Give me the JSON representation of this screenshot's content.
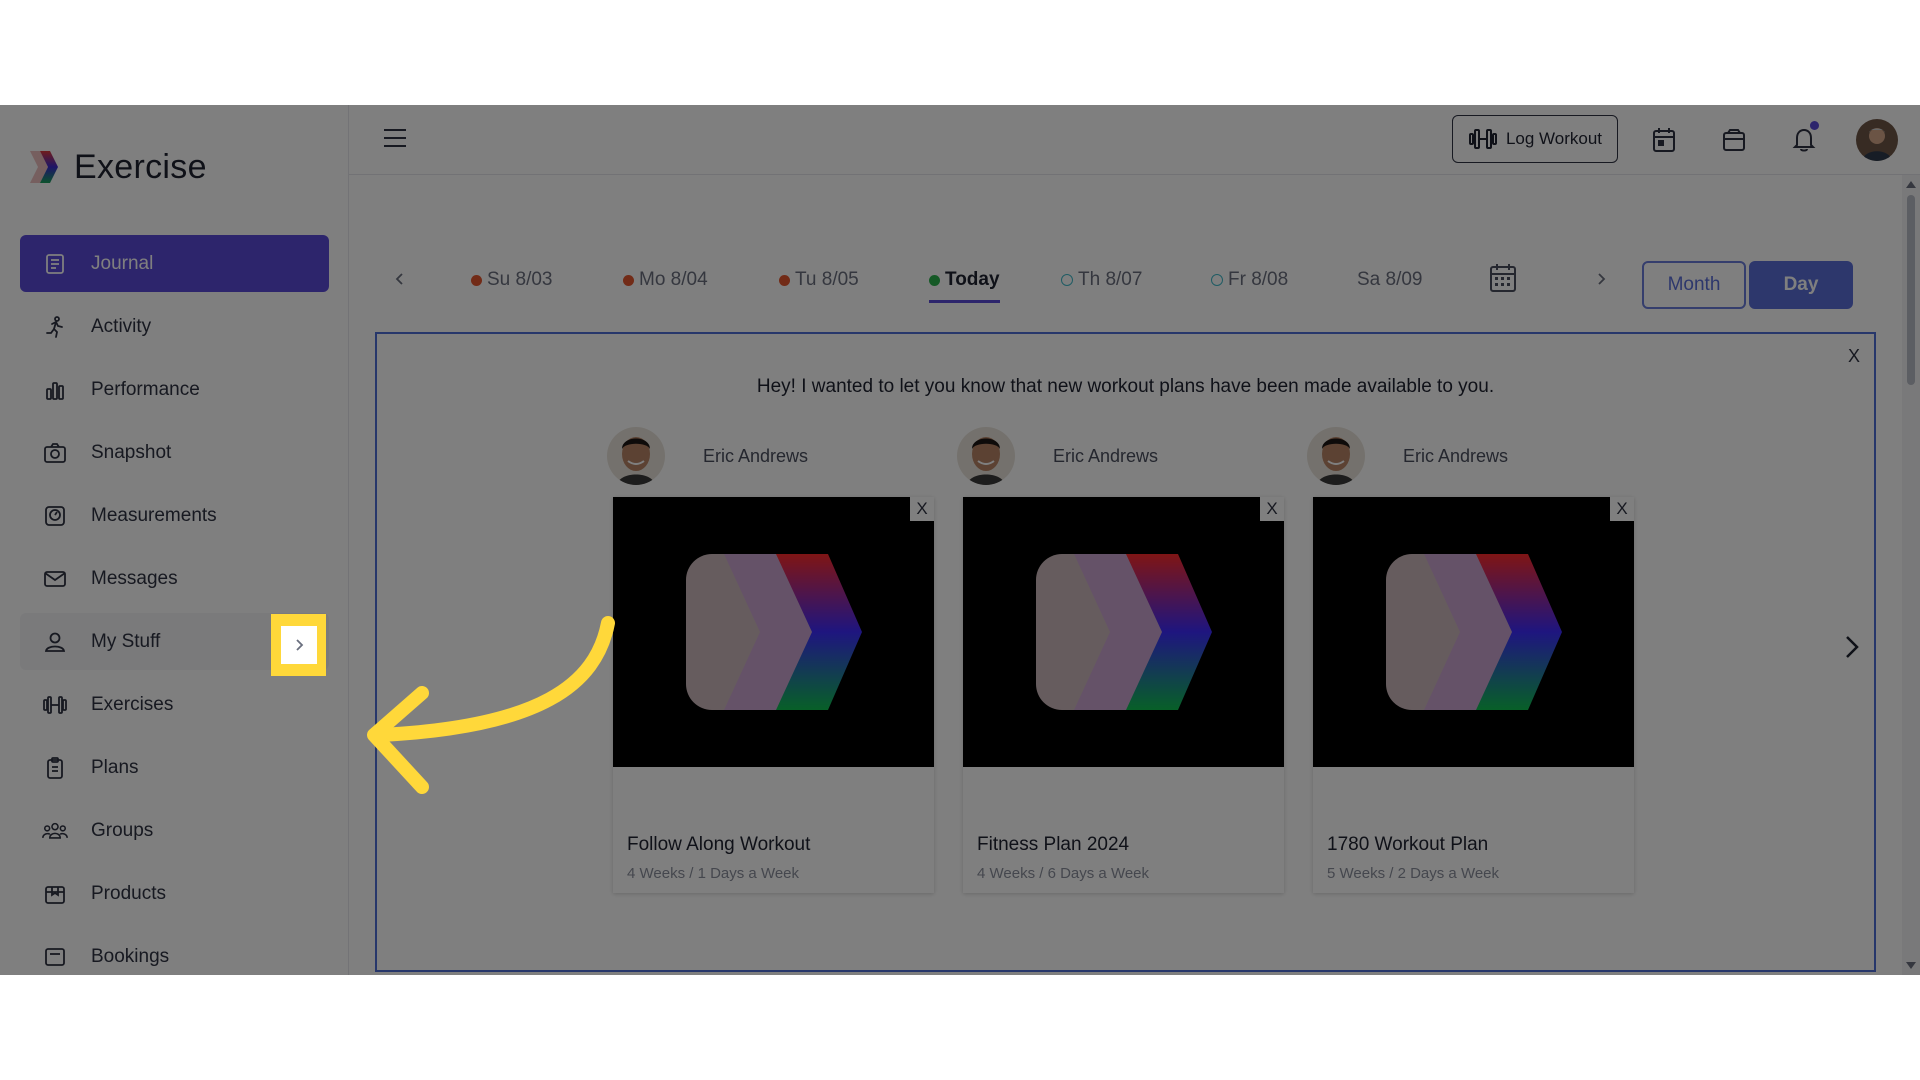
{
  "brand": {
    "name": "Exercise"
  },
  "sidebar": {
    "items": [
      {
        "label": "Journal",
        "icon": "journal-icon"
      },
      {
        "label": "Activity",
        "icon": "running-icon"
      },
      {
        "label": "Performance",
        "icon": "bar-chart-icon"
      },
      {
        "label": "Snapshot",
        "icon": "camera-icon"
      },
      {
        "label": "Measurements",
        "icon": "scale-icon"
      },
      {
        "label": "Messages",
        "icon": "envelope-icon"
      },
      {
        "label": "My Stuff",
        "icon": "user-icon"
      },
      {
        "label": "Exercises",
        "icon": "dumbbell-icon"
      },
      {
        "label": "Plans",
        "icon": "clipboard-icon"
      },
      {
        "label": "Groups",
        "icon": "group-icon"
      },
      {
        "label": "Products",
        "icon": "box-icon"
      },
      {
        "label": "Bookings",
        "icon": "booking-icon"
      }
    ]
  },
  "topbar": {
    "log_workout": "Log Workout"
  },
  "datebar": {
    "days": [
      {
        "label": "Su 8/03",
        "status": "done"
      },
      {
        "label": "Mo 8/04",
        "status": "done"
      },
      {
        "label": "Tu 8/05",
        "status": "done"
      },
      {
        "label": "Today",
        "status": "today"
      },
      {
        "label": "Th 8/07",
        "status": "future"
      },
      {
        "label": "Fr 8/08",
        "status": "future"
      },
      {
        "label": "Sa 8/09",
        "status": "none"
      }
    ],
    "month_label": "Month",
    "day_label": "Day"
  },
  "message": {
    "text": "Hey! I wanted to let you know that new workout plans have been made available to you.",
    "close": "X",
    "plans": [
      {
        "author": "Eric Andrews",
        "title": "Follow Along Workout",
        "subtitle": "4 Weeks / 1 Days a Week",
        "close": "X"
      },
      {
        "author": "Eric Andrews",
        "title": "Fitness Plan 2024",
        "subtitle": "4 Weeks / 6 Days a Week",
        "close": "X"
      },
      {
        "author": "Eric Andrews",
        "title": "1780 Workout Plan",
        "subtitle": "5 Weeks / 2 Days a Week",
        "close": "X"
      }
    ]
  },
  "colors": {
    "accent": "#5b4ad8",
    "highlight": "#ffd83a",
    "border_blue": "#4f6fd6"
  }
}
